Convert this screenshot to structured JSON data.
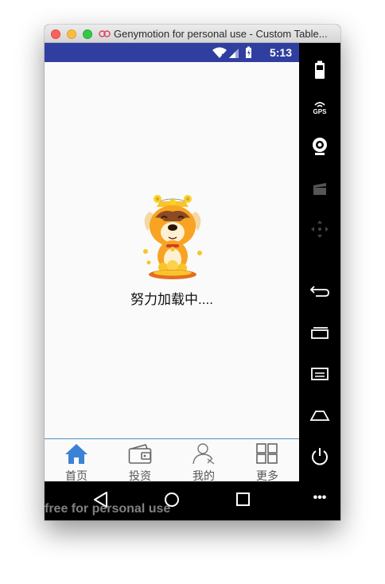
{
  "window": {
    "title": "Genymotion for personal use - Custom Table...",
    "controls": [
      "close",
      "minimize",
      "maximize"
    ]
  },
  "status_bar": {
    "time": "5:13",
    "icons": [
      "wifi-icon",
      "signal-icon",
      "battery-icon"
    ],
    "background": "#303f9f"
  },
  "content": {
    "loading_text": "努力加载中....",
    "image": "dog-mascot-with-gold-coins"
  },
  "tabs": [
    {
      "label": "首页",
      "icon": "home-icon",
      "active": true,
      "color": "#3b82d6"
    },
    {
      "label": "投资",
      "icon": "wallet-icon",
      "active": false,
      "color": "#666666"
    },
    {
      "label": "我的",
      "icon": "user-icon",
      "active": false,
      "color": "#666666"
    },
    {
      "label": "更多",
      "icon": "grid-icon",
      "active": false,
      "color": "#666666"
    }
  ],
  "nav_bar": {
    "buttons": [
      "back",
      "home",
      "recents"
    ]
  },
  "watermark": "free for personal use",
  "sidebar": {
    "buttons": [
      "battery",
      "gps",
      "camera",
      "capture",
      "dpad",
      "back",
      "recents",
      "menu",
      "home",
      "power",
      "more"
    ],
    "gps_label": "GPS",
    "more_label": "•••"
  }
}
